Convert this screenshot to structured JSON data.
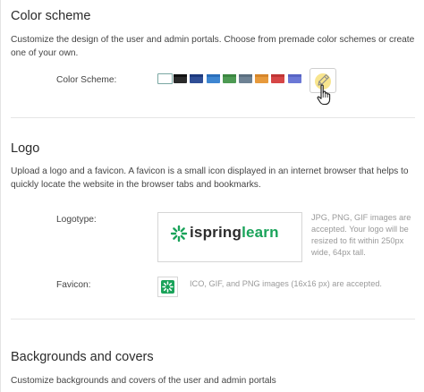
{
  "color_scheme": {
    "title": "Color scheme",
    "description": "Customize the design of the user and admin portals. Choose from premade color schemes or create one of your own.",
    "label": "Color Scheme:",
    "swatches": [
      {
        "name": "white-green",
        "color": "#ffffff",
        "stripe": "#ffffff",
        "selected": true
      },
      {
        "name": "black",
        "color": "#2a2a2a",
        "stripe": "#111111",
        "selected": false
      },
      {
        "name": "navy",
        "color": "#2f4e96",
        "stripe": "#1d3a7e",
        "selected": false
      },
      {
        "name": "blue",
        "color": "#3e86d1",
        "stripe": "#2a6fbb",
        "selected": false
      },
      {
        "name": "green",
        "color": "#4d9a53",
        "stripe": "#3b8640",
        "selected": false
      },
      {
        "name": "slate",
        "color": "#6e8294",
        "stripe": "#5b6f80",
        "selected": false
      },
      {
        "name": "orange",
        "color": "#e79a3c",
        "stripe": "#d6862a",
        "selected": false
      },
      {
        "name": "red",
        "color": "#d64646",
        "stripe": "#bf3535",
        "selected": false
      },
      {
        "name": "periwinkle",
        "color": "#6b78d6",
        "stripe": "#5864c4",
        "selected": false
      }
    ],
    "custom_button_icon": "pencil-icon",
    "cursor_icon": "hand-pointer-icon"
  },
  "logo": {
    "title": "Logo",
    "description": "Upload a logo and a favicon. A favicon is a small icon displayed in an internet browser that helps to quickly locate the website in the browser tabs and bookmarks.",
    "logotype_label": "Logotype:",
    "logotype_text_part1": "ispring",
    "logotype_text_part2": "learn",
    "logotype_note": "JPG, PNG, GIF images are accepted. Your logo will be resized to fit within 250px wide, 64px tall.",
    "favicon_label": "Favicon:",
    "favicon_note": "ICO, GIF, and PNG images (16x16 px) are accepted.",
    "brand_color": "#1aa35a"
  },
  "backgrounds": {
    "title": "Backgrounds and covers",
    "description": "Customize backgrounds and covers of the user and admin portals"
  }
}
